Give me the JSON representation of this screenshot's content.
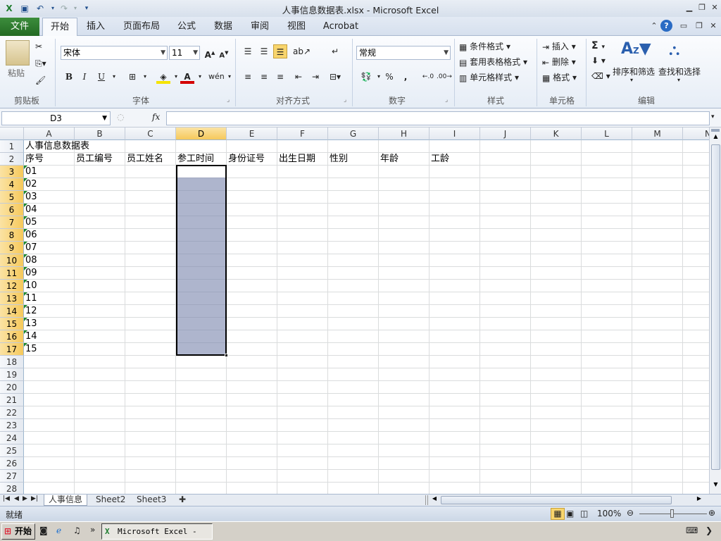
{
  "window": {
    "title": "人事信息数据表.xlsx  -  Microsoft Excel"
  },
  "ribbon_tabs": [
    "文件",
    "开始",
    "插入",
    "页面布局",
    "公式",
    "数据",
    "审阅",
    "视图",
    "Acrobat"
  ],
  "active_tab": "开始",
  "ribbon": {
    "clipboard": {
      "paste_label": "粘贴",
      "group_label": "剪贴板"
    },
    "font": {
      "font_name": "宋体",
      "font_size": "11",
      "bold": "B",
      "italic": "I",
      "underline": "U",
      "group_label": "字体"
    },
    "alignment": {
      "group_label": "对齐方式"
    },
    "number": {
      "format": "常规",
      "percent": "%",
      "comma": ",",
      "group_label": "数字"
    },
    "styles": {
      "conditional_format": "条件格式",
      "table_format": "套用表格格式",
      "cell_styles": "单元格样式",
      "group_label": "样式"
    },
    "cells": {
      "insert": "插入",
      "delete": "删除",
      "format": "格式",
      "group_label": "单元格"
    },
    "editing": {
      "sum": "Σ",
      "sort_filter": "排序和筛选",
      "find_select": "查找和选择",
      "group_label": "编辑"
    }
  },
  "formula_bar": {
    "name_box": "D3",
    "fx": "fx",
    "formula": ""
  },
  "columns": [
    "A",
    "B",
    "C",
    "D",
    "E",
    "F",
    "G",
    "H",
    "I",
    "J",
    "K",
    "L",
    "M",
    "N"
  ],
  "selected_column": "D",
  "rows": [
    "1",
    "2",
    "3",
    "4",
    "5",
    "6",
    "7",
    "8",
    "9",
    "10",
    "11",
    "12",
    "13",
    "14",
    "15",
    "16",
    "17",
    "18",
    "19",
    "20",
    "21",
    "22",
    "23",
    "24",
    "25",
    "26",
    "27",
    "28"
  ],
  "sheet": {
    "title_cell": "人事信息数据表",
    "headers": [
      "序号",
      "员工编号",
      "员工姓名",
      "参工时间",
      "身份证号",
      "出生日期",
      "性别",
      "年龄",
      "工龄"
    ],
    "serials": [
      "01",
      "02",
      "03",
      "04",
      "05",
      "06",
      "07",
      "08",
      "09",
      "10",
      "11",
      "12",
      "13",
      "14",
      "15"
    ]
  },
  "sheet_tabs": [
    "人事信息",
    "Sheet2",
    "Sheet3"
  ],
  "active_sheet": "人事信息",
  "status": {
    "ready": "就绪",
    "zoom": "100%"
  },
  "taskbar": {
    "start": "开始",
    "app": "Microsoft Excel - ..."
  },
  "colors": {
    "selection_fill": "#8c93b6",
    "file_tab": "#2f7d2f",
    "header_selected": "#f6c95b"
  }
}
